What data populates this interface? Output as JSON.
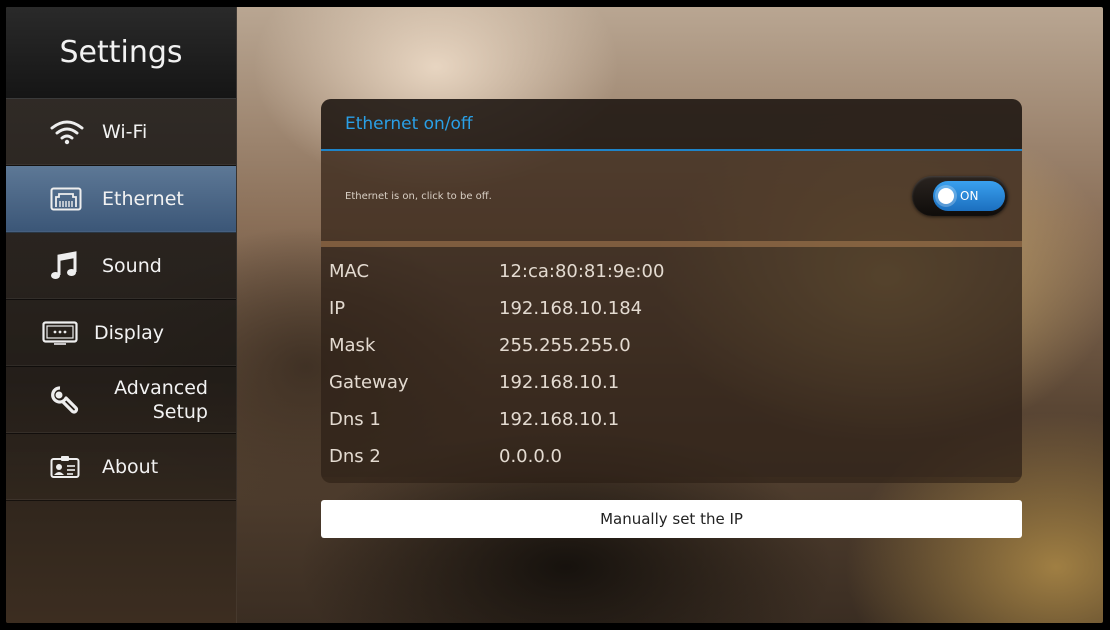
{
  "sidebar": {
    "title": "Settings",
    "items": [
      {
        "label": "Wi-Fi",
        "icon": "wifi-icon"
      },
      {
        "label": "Ethernet",
        "icon": "ethernet-icon",
        "active": true
      },
      {
        "label": "Sound",
        "icon": "music-note-icon"
      },
      {
        "label": "Display",
        "icon": "display-icon"
      },
      {
        "label_line1": "Advanced",
        "label_line2": "Setup",
        "icon": "wrench-icon"
      },
      {
        "label": "About",
        "icon": "id-card-icon"
      }
    ]
  },
  "panel": {
    "header": "Ethernet on/off",
    "toggle_description": "Ethernet is on, click to be off.",
    "toggle_state": "ON",
    "info": [
      {
        "key": "MAC",
        "value": "12:ca:80:81:9e:00"
      },
      {
        "key": "IP",
        "value": "192.168.10.184"
      },
      {
        "key": "Mask",
        "value": "255.255.255.0"
      },
      {
        "key": "Gateway",
        "value": "192.168.10.1"
      },
      {
        "key": "Dns 1",
        "value": "192.168.10.1"
      },
      {
        "key": "Dns 2",
        "value": "0.0.0.0"
      }
    ],
    "manual_button": "Manually set the IP"
  },
  "colors": {
    "accent": "#2a9fe6",
    "active_item": "#4b6688",
    "toggle_on": "#2a8ad8"
  }
}
